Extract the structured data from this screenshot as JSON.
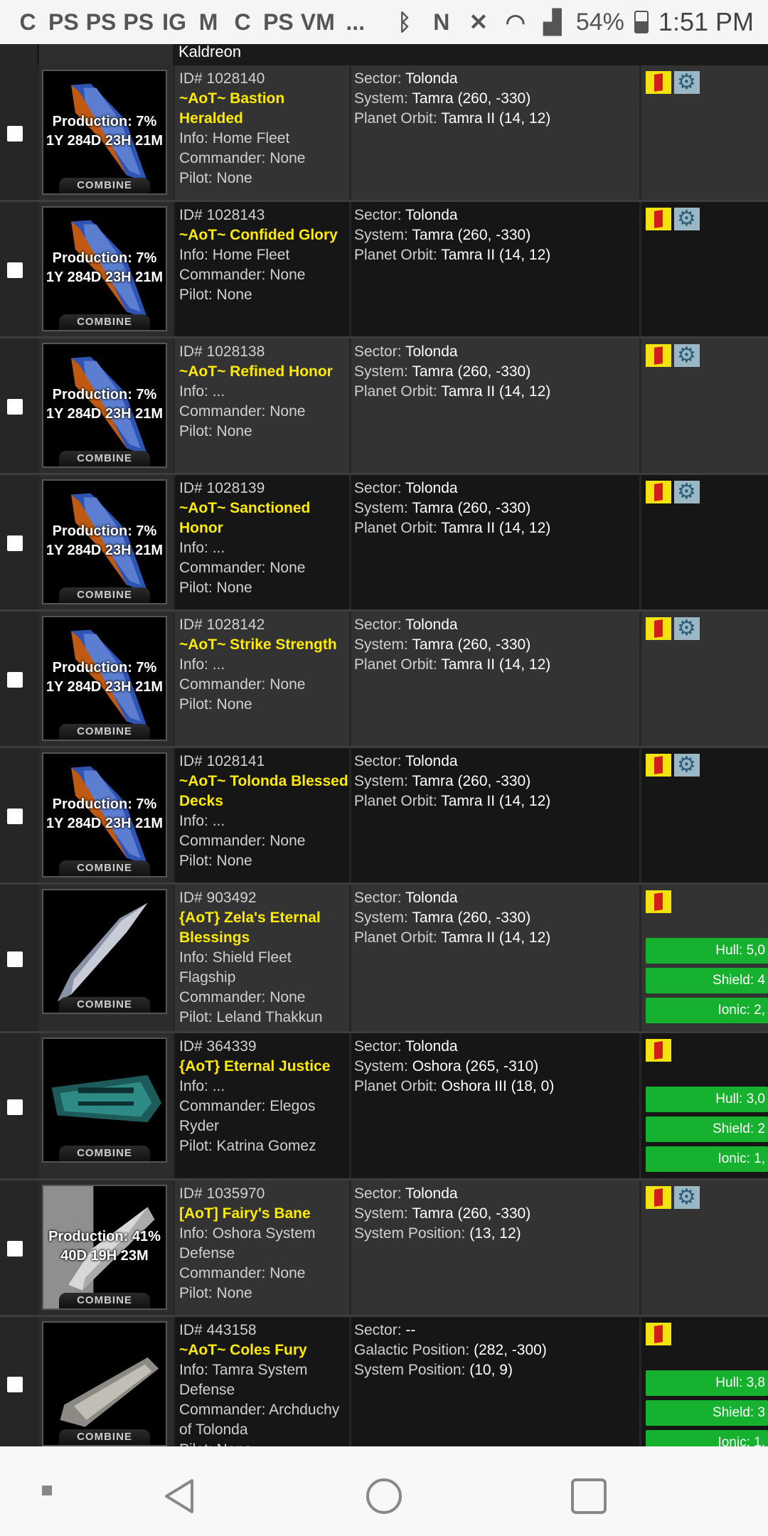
{
  "status_bar": {
    "notification_icons": [
      "C",
      "PS",
      "PS",
      "PS",
      "IG",
      "M",
      "C",
      "PS",
      "VM",
      "..."
    ],
    "battery": "54%",
    "time": "1:51 PM"
  },
  "top_row": {
    "info_tail": "Kaldreon"
  },
  "ships": [
    {
      "id": "1028140",
      "name": "~AoT~ Bastion Heralded",
      "info": "Home Fleet",
      "commander": "None",
      "pilot": "None",
      "sector": "Tolonda",
      "line2_label": "System:",
      "line2_value": "Tamra (260, -330)",
      "line3_label": "Planet Orbit:",
      "line3_value": "Tamra II (14, 12)",
      "production": "Production: 7%",
      "eta": "1Y 284D 23H 21M",
      "art": "blue",
      "banner": "COMBINE",
      "has_gear": true,
      "stats": []
    },
    {
      "id": "1028143",
      "name": "~AoT~ Confided Glory",
      "info": "Home Fleet",
      "commander": "None",
      "pilot": "None",
      "sector": "Tolonda",
      "line2_label": "System:",
      "line2_value": "Tamra (260, -330)",
      "line3_label": "Planet Orbit:",
      "line3_value": "Tamra II (14, 12)",
      "production": "Production: 7%",
      "eta": "1Y 284D 23H 21M",
      "art": "blue",
      "banner": "COMBINE",
      "has_gear": true,
      "stats": []
    },
    {
      "id": "1028138",
      "name": "~AoT~ Refined Honor",
      "info": "...",
      "commander": "None",
      "pilot": "None",
      "sector": "Tolonda",
      "line2_label": "System:",
      "line2_value": "Tamra (260, -330)",
      "line3_label": "Planet Orbit:",
      "line3_value": "Tamra II (14, 12)",
      "production": "Production: 7%",
      "eta": "1Y 284D 23H 21M",
      "art": "blue",
      "banner": "COMBINE",
      "has_gear": true,
      "stats": []
    },
    {
      "id": "1028139",
      "name": "~AoT~ Sanctioned Honor",
      "info": "...",
      "commander": "None",
      "pilot": "None",
      "sector": "Tolonda",
      "line2_label": "System:",
      "line2_value": "Tamra (260, -330)",
      "line3_label": "Planet Orbit:",
      "line3_value": "Tamra II (14, 12)",
      "production": "Production: 7%",
      "eta": "1Y 284D 23H 21M",
      "art": "blue",
      "banner": "COMBINE",
      "has_gear": true,
      "stats": []
    },
    {
      "id": "1028142",
      "name": "~AoT~ Strike Strength",
      "info": "...",
      "commander": "None",
      "pilot": "None",
      "sector": "Tolonda",
      "line2_label": "System:",
      "line2_value": "Tamra (260, -330)",
      "line3_label": "Planet Orbit:",
      "line3_value": "Tamra II (14, 12)",
      "production": "Production: 7%",
      "eta": "1Y 284D 23H 21M",
      "art": "blue",
      "banner": "COMBINE",
      "has_gear": true,
      "stats": []
    },
    {
      "id": "1028141",
      "name": "~AoT~ Tolonda Blessed Decks",
      "info": "...",
      "commander": "None",
      "pilot": "None",
      "sector": "Tolonda",
      "line2_label": "System:",
      "line2_value": "Tamra (260, -330)",
      "line3_label": "Planet Orbit:",
      "line3_value": "Tamra II (14, 12)",
      "production": "Production: 7%",
      "eta": "1Y 284D 23H 21M",
      "art": "blue",
      "banner": "COMBINE",
      "has_gear": true,
      "stats": []
    },
    {
      "id": "903492",
      "name": "{AoT} Zela's Eternal Blessings",
      "info": "Shield Fleet Flagship",
      "commander": "None",
      "pilot": "Leland Thakkun",
      "sector": "Tolonda",
      "line2_label": "System:",
      "line2_value": "Tamra (260, -330)",
      "line3_label": "Planet Orbit:",
      "line3_value": "Tamra II (14, 12)",
      "production": "",
      "eta": "",
      "art": "silver",
      "banner": "COMBINE",
      "has_gear": false,
      "stats": [
        "Hull: 5,0",
        "Shield: 4",
        "Ionic: 2,"
      ]
    },
    {
      "id": "364339",
      "name": "{AoT} Eternal Justice",
      "info": "...",
      "commander": "Elegos Ryder",
      "pilot": "Katrina Gomez",
      "sector": "Tolonda",
      "line2_label": "System:",
      "line2_value": "Oshora (265, -310)",
      "line3_label": "Planet Orbit:",
      "line3_value": "Oshora III (18, 0)",
      "production": "",
      "eta": "",
      "art": "teal",
      "banner": "COMBINE",
      "has_gear": false,
      "stats": [
        "Hull: 3,0",
        "Shield: 2",
        "Ionic: 1,"
      ]
    },
    {
      "id": "1035970",
      "name": "[AoT] Fairy's Bane",
      "info": "Oshora System Defense",
      "commander": "None",
      "pilot": "None",
      "sector": "Tolonda",
      "line2_label": "System:",
      "line2_value": "Tamra (260, -330)",
      "line3_label": "System Position:",
      "line3_value": "(13, 12)",
      "production": "Production: 41%",
      "eta": "40D 19H 23M",
      "art": "white",
      "banner": "COMBINE",
      "has_gear": true,
      "stats": []
    },
    {
      "id": "443158",
      "name": "~AoT~ Coles Fury",
      "info": "Tamra System Defense",
      "commander": "Archduchy of Tolonda",
      "pilot": "None",
      "sector": "--",
      "line2_label": "Galactic Position:",
      "line2_value": "(282, -300)",
      "line3_label": "System Position:",
      "line3_value": "(10, 9)",
      "production": "",
      "eta": "",
      "art": "grey",
      "banner": "COMBINE",
      "has_gear": false,
      "stats": [
        "Hull: 3,8",
        "Shield: 3",
        "Ionic: 1,"
      ]
    }
  ],
  "labels": {
    "id": "ID#",
    "info": "Info:",
    "commander": "Commander:",
    "pilot": "Pilot:",
    "sector": "Sector:"
  },
  "nav": {
    "back": "back",
    "home": "home",
    "recents": "recents",
    "menu": "menu"
  }
}
